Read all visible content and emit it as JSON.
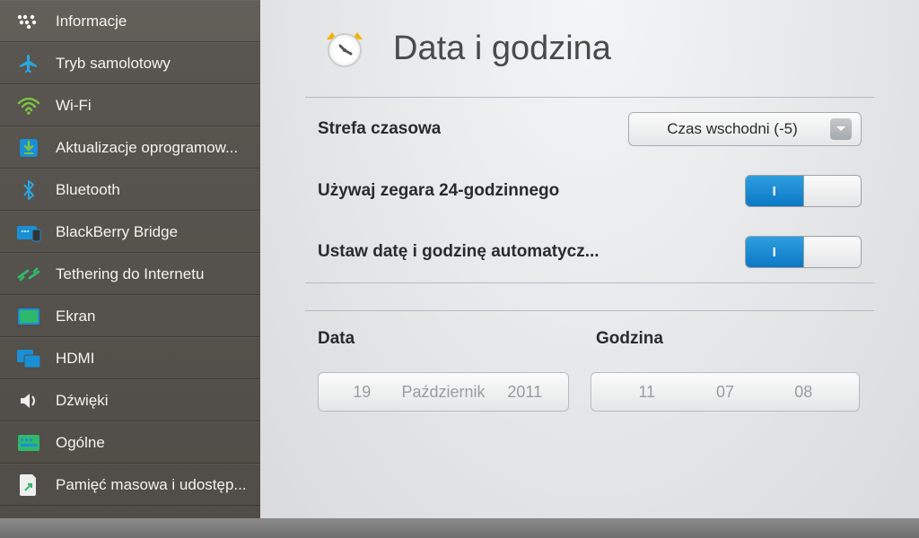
{
  "sidebar": {
    "items": [
      {
        "label": "Informacje",
        "icon": "bb-logo"
      },
      {
        "label": "Tryb samolotowy",
        "icon": "airplane"
      },
      {
        "label": "Wi-Fi",
        "icon": "wifi"
      },
      {
        "label": "Aktualizacje oprogramow...",
        "icon": "download"
      },
      {
        "label": "Bluetooth",
        "icon": "bluetooth"
      },
      {
        "label": "BlackBerry Bridge",
        "icon": "bridge"
      },
      {
        "label": "Tethering do Internetu",
        "icon": "tether"
      },
      {
        "label": "Ekran",
        "icon": "screen"
      },
      {
        "label": "HDMI",
        "icon": "hdmi"
      },
      {
        "label": "Dźwięki",
        "icon": "sound"
      },
      {
        "label": "Ogólne",
        "icon": "general"
      },
      {
        "label": "Pamięć masowa i udostęp...",
        "icon": "storage"
      }
    ]
  },
  "header": {
    "title": "Data i godzina"
  },
  "main": {
    "timezone_label": "Strefa czasowa",
    "timezone_value": "Czas wschodni (-5)",
    "clock24_label": "Używaj zegara 24-godzinnego",
    "clock24_state": "I",
    "autoset_label": "Ustaw datę i godzinę automatycz...",
    "autoset_state": "I",
    "date_section": "Data",
    "time_section": "Godzina",
    "date": {
      "day": "19",
      "month": "Październik",
      "year": "2011"
    },
    "time": {
      "h": "11",
      "m": "07",
      "s": "08"
    }
  }
}
